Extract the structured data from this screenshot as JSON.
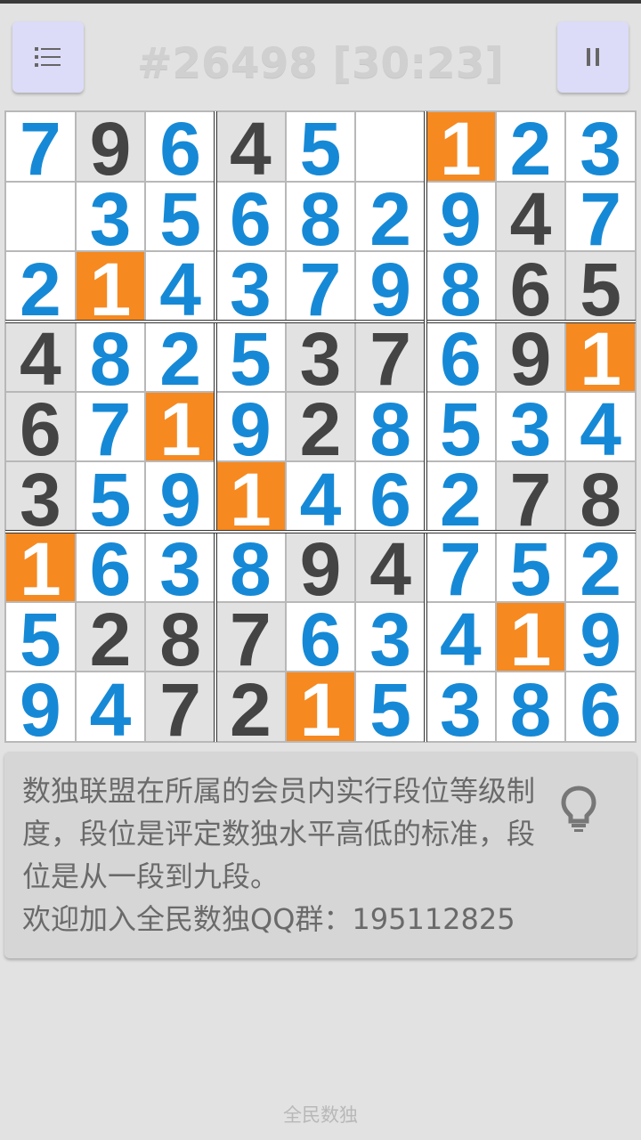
{
  "header": {
    "title": "#26498 [30:23]",
    "menu_icon": "list-icon",
    "pause_icon": "pause-icon"
  },
  "board": {
    "rows": [
      [
        "7",
        "9",
        "6",
        "4",
        "5",
        "",
        "1",
        "2",
        "3"
      ],
      [
        "",
        "3",
        "5",
        "6",
        "8",
        "2",
        "9",
        "4",
        "7"
      ],
      [
        "2",
        "1",
        "4",
        "3",
        "7",
        "9",
        "8",
        "6",
        "5"
      ],
      [
        "4",
        "8",
        "2",
        "5",
        "3",
        "7",
        "6",
        "9",
        "1"
      ],
      [
        "6",
        "7",
        "1",
        "9",
        "2",
        "8",
        "5",
        "3",
        "4"
      ],
      [
        "3",
        "5",
        "9",
        "1",
        "4",
        "6",
        "2",
        "7",
        "8"
      ],
      [
        "1",
        "6",
        "3",
        "8",
        "9",
        "4",
        "7",
        "5",
        "2"
      ],
      [
        "5",
        "2",
        "8",
        "7",
        "6",
        "3",
        "4",
        "1",
        "9"
      ],
      [
        "9",
        "4",
        "7",
        "2",
        "1",
        "5",
        "3",
        "8",
        "6"
      ]
    ],
    "types": [
      [
        "u",
        "g",
        "u",
        "g",
        "u",
        "e",
        "h",
        "u",
        "u"
      ],
      [
        "e",
        "u",
        "u",
        "u",
        "u",
        "u",
        "u",
        "g",
        "u"
      ],
      [
        "u",
        "h",
        "u",
        "u",
        "u",
        "u",
        "u",
        "g",
        "g"
      ],
      [
        "g",
        "u",
        "u",
        "u",
        "g",
        "g",
        "u",
        "g",
        "h"
      ],
      [
        "g",
        "u",
        "h",
        "u",
        "g",
        "u",
        "u",
        "u",
        "u"
      ],
      [
        "g",
        "u",
        "u",
        "h",
        "u",
        "u",
        "u",
        "g",
        "g"
      ],
      [
        "h",
        "u",
        "u",
        "u",
        "g",
        "g",
        "u",
        "u",
        "u"
      ],
      [
        "u",
        "g",
        "g",
        "g",
        "u",
        "u",
        "u",
        "h",
        "u"
      ],
      [
        "u",
        "u",
        "g",
        "g",
        "h",
        "u",
        "u",
        "u",
        "u"
      ]
    ],
    "colors": {
      "given": "#444444",
      "user": "#1689d6",
      "highlight": "#f6891f"
    }
  },
  "tip": {
    "text": "数独联盟在所属的会员内实行段位等级制度，段位是评定数独水平高低的标准，段位是从一段到九段。",
    "qq_line": "欢迎加入全民数独QQ群：195112825",
    "icon": "lightbulb-icon"
  },
  "footer": {
    "app_name": "全民数独"
  }
}
